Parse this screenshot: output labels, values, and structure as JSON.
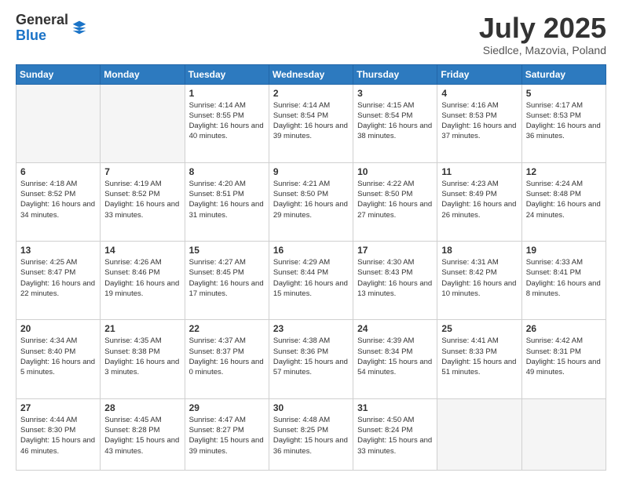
{
  "logo": {
    "general": "General",
    "blue": "Blue"
  },
  "header": {
    "title": "July 2025",
    "subtitle": "Siedlce, Mazovia, Poland"
  },
  "days_of_week": [
    "Sunday",
    "Monday",
    "Tuesday",
    "Wednesday",
    "Thursday",
    "Friday",
    "Saturday"
  ],
  "weeks": [
    [
      {
        "day": null
      },
      {
        "day": null
      },
      {
        "day": "1",
        "sunrise": "Sunrise: 4:14 AM",
        "sunset": "Sunset: 8:55 PM",
        "daylight": "Daylight: 16 hours and 40 minutes."
      },
      {
        "day": "2",
        "sunrise": "Sunrise: 4:14 AM",
        "sunset": "Sunset: 8:54 PM",
        "daylight": "Daylight: 16 hours and 39 minutes."
      },
      {
        "day": "3",
        "sunrise": "Sunrise: 4:15 AM",
        "sunset": "Sunset: 8:54 PM",
        "daylight": "Daylight: 16 hours and 38 minutes."
      },
      {
        "day": "4",
        "sunrise": "Sunrise: 4:16 AM",
        "sunset": "Sunset: 8:53 PM",
        "daylight": "Daylight: 16 hours and 37 minutes."
      },
      {
        "day": "5",
        "sunrise": "Sunrise: 4:17 AM",
        "sunset": "Sunset: 8:53 PM",
        "daylight": "Daylight: 16 hours and 36 minutes."
      }
    ],
    [
      {
        "day": "6",
        "sunrise": "Sunrise: 4:18 AM",
        "sunset": "Sunset: 8:52 PM",
        "daylight": "Daylight: 16 hours and 34 minutes."
      },
      {
        "day": "7",
        "sunrise": "Sunrise: 4:19 AM",
        "sunset": "Sunset: 8:52 PM",
        "daylight": "Daylight: 16 hours and 33 minutes."
      },
      {
        "day": "8",
        "sunrise": "Sunrise: 4:20 AM",
        "sunset": "Sunset: 8:51 PM",
        "daylight": "Daylight: 16 hours and 31 minutes."
      },
      {
        "day": "9",
        "sunrise": "Sunrise: 4:21 AM",
        "sunset": "Sunset: 8:50 PM",
        "daylight": "Daylight: 16 hours and 29 minutes."
      },
      {
        "day": "10",
        "sunrise": "Sunrise: 4:22 AM",
        "sunset": "Sunset: 8:50 PM",
        "daylight": "Daylight: 16 hours and 27 minutes."
      },
      {
        "day": "11",
        "sunrise": "Sunrise: 4:23 AM",
        "sunset": "Sunset: 8:49 PM",
        "daylight": "Daylight: 16 hours and 26 minutes."
      },
      {
        "day": "12",
        "sunrise": "Sunrise: 4:24 AM",
        "sunset": "Sunset: 8:48 PM",
        "daylight": "Daylight: 16 hours and 24 minutes."
      }
    ],
    [
      {
        "day": "13",
        "sunrise": "Sunrise: 4:25 AM",
        "sunset": "Sunset: 8:47 PM",
        "daylight": "Daylight: 16 hours and 22 minutes."
      },
      {
        "day": "14",
        "sunrise": "Sunrise: 4:26 AM",
        "sunset": "Sunset: 8:46 PM",
        "daylight": "Daylight: 16 hours and 19 minutes."
      },
      {
        "day": "15",
        "sunrise": "Sunrise: 4:27 AM",
        "sunset": "Sunset: 8:45 PM",
        "daylight": "Daylight: 16 hours and 17 minutes."
      },
      {
        "day": "16",
        "sunrise": "Sunrise: 4:29 AM",
        "sunset": "Sunset: 8:44 PM",
        "daylight": "Daylight: 16 hours and 15 minutes."
      },
      {
        "day": "17",
        "sunrise": "Sunrise: 4:30 AM",
        "sunset": "Sunset: 8:43 PM",
        "daylight": "Daylight: 16 hours and 13 minutes."
      },
      {
        "day": "18",
        "sunrise": "Sunrise: 4:31 AM",
        "sunset": "Sunset: 8:42 PM",
        "daylight": "Daylight: 16 hours and 10 minutes."
      },
      {
        "day": "19",
        "sunrise": "Sunrise: 4:33 AM",
        "sunset": "Sunset: 8:41 PM",
        "daylight": "Daylight: 16 hours and 8 minutes."
      }
    ],
    [
      {
        "day": "20",
        "sunrise": "Sunrise: 4:34 AM",
        "sunset": "Sunset: 8:40 PM",
        "daylight": "Daylight: 16 hours and 5 minutes."
      },
      {
        "day": "21",
        "sunrise": "Sunrise: 4:35 AM",
        "sunset": "Sunset: 8:38 PM",
        "daylight": "Daylight: 16 hours and 3 minutes."
      },
      {
        "day": "22",
        "sunrise": "Sunrise: 4:37 AM",
        "sunset": "Sunset: 8:37 PM",
        "daylight": "Daylight: 16 hours and 0 minutes."
      },
      {
        "day": "23",
        "sunrise": "Sunrise: 4:38 AM",
        "sunset": "Sunset: 8:36 PM",
        "daylight": "Daylight: 15 hours and 57 minutes."
      },
      {
        "day": "24",
        "sunrise": "Sunrise: 4:39 AM",
        "sunset": "Sunset: 8:34 PM",
        "daylight": "Daylight: 15 hours and 54 minutes."
      },
      {
        "day": "25",
        "sunrise": "Sunrise: 4:41 AM",
        "sunset": "Sunset: 8:33 PM",
        "daylight": "Daylight: 15 hours and 51 minutes."
      },
      {
        "day": "26",
        "sunrise": "Sunrise: 4:42 AM",
        "sunset": "Sunset: 8:31 PM",
        "daylight": "Daylight: 15 hours and 49 minutes."
      }
    ],
    [
      {
        "day": "27",
        "sunrise": "Sunrise: 4:44 AM",
        "sunset": "Sunset: 8:30 PM",
        "daylight": "Daylight: 15 hours and 46 minutes."
      },
      {
        "day": "28",
        "sunrise": "Sunrise: 4:45 AM",
        "sunset": "Sunset: 8:28 PM",
        "daylight": "Daylight: 15 hours and 43 minutes."
      },
      {
        "day": "29",
        "sunrise": "Sunrise: 4:47 AM",
        "sunset": "Sunset: 8:27 PM",
        "daylight": "Daylight: 15 hours and 39 minutes."
      },
      {
        "day": "30",
        "sunrise": "Sunrise: 4:48 AM",
        "sunset": "Sunset: 8:25 PM",
        "daylight": "Daylight: 15 hours and 36 minutes."
      },
      {
        "day": "31",
        "sunrise": "Sunrise: 4:50 AM",
        "sunset": "Sunset: 8:24 PM",
        "daylight": "Daylight: 15 hours and 33 minutes."
      },
      {
        "day": null
      },
      {
        "day": null
      }
    ]
  ]
}
